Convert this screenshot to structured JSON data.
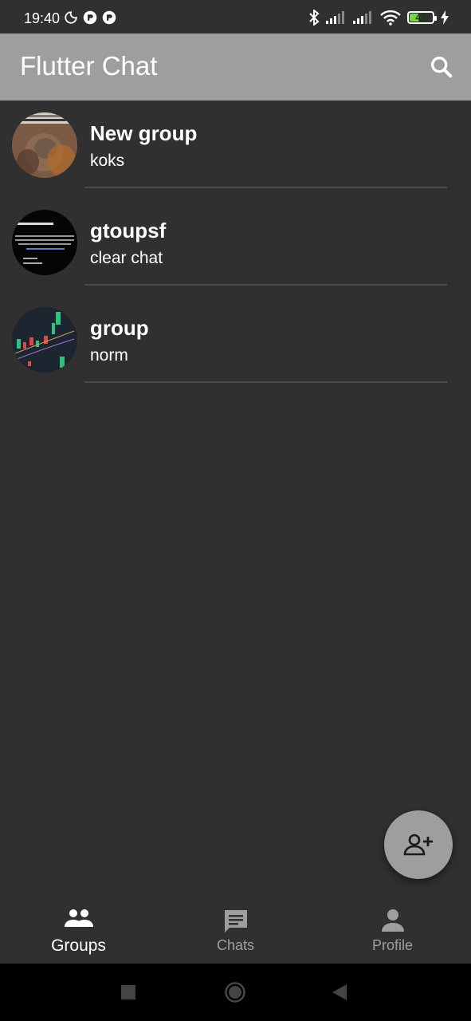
{
  "status_bar": {
    "time": "19:40",
    "battery_level": "43",
    "battery_fraction": 0.43
  },
  "app_bar": {
    "title": "Flutter Chat",
    "search_icon": "search-icon"
  },
  "groups": [
    {
      "title": "New group",
      "subtitle": "koks"
    },
    {
      "title": "gtoupsf",
      "subtitle": "clear chat"
    },
    {
      "title": "group",
      "subtitle": "norm"
    }
  ],
  "fab": {
    "icon": "add-person-icon"
  },
  "bottom_nav": [
    {
      "label": "Groups",
      "icon": "groups-icon",
      "active": true
    },
    {
      "label": "Chats",
      "icon": "chat-icon",
      "active": false
    },
    {
      "label": "Profile",
      "icon": "person-icon",
      "active": false
    }
  ],
  "colors": {
    "background": "#303030",
    "app_bar": "#9e9e9e",
    "text": "#ffffff",
    "inactive": "#9e9e9e",
    "battery": "#7ad14b"
  }
}
